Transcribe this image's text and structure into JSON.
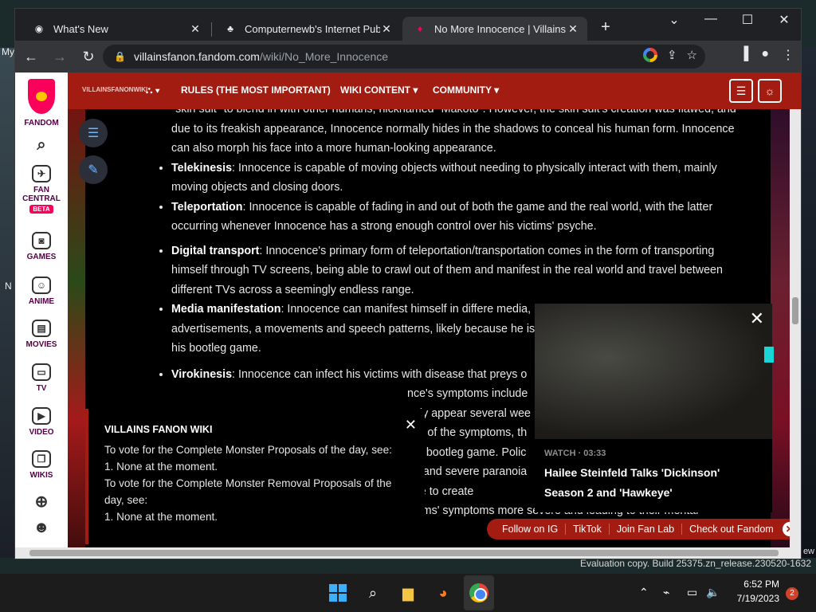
{
  "browser": {
    "tabs": [
      {
        "title": "What's New",
        "icon": "chrome-icon"
      },
      {
        "title": "Computernewb's Internet Pub H",
        "icon": "pub-icon"
      },
      {
        "title": "No More Innocence | Villains Far",
        "icon": "fandom-icon"
      }
    ],
    "url_domain": "villainsfanon.fandom.com",
    "url_path": "/wiki/No_More_Innocence"
  },
  "desktop": {
    "label_my": "My",
    "label_n": "N",
    "label_ew": "ew",
    "watermark": "Evaluation copy. Build 25375.zn_release.230520-1632"
  },
  "rail": {
    "brand": "FANDOM",
    "items": [
      {
        "label": "FAN CENTRAL",
        "badge": "BETA"
      },
      {
        "label": "GAMES"
      },
      {
        "label": "ANIME"
      },
      {
        "label": "MOVIES"
      },
      {
        "label": "TV"
      },
      {
        "label": "VIDEO"
      },
      {
        "label": "WIKIS"
      }
    ]
  },
  "wiki_nav": {
    "logo_text": "VILLAINSFANONWIKI",
    "items": [
      "RULES (THE MOST IMPORTANT)",
      "WIKI CONTENT",
      "COMMUNITY"
    ]
  },
  "article": {
    "intro": "\"skin suit\" to blend in with other humans, nicknamed \"Makoto\". However, the skin suit's creation was flawed, and due to its freakish appearance, Innocence normally hides in the shadows to conceal his human form. Innocence can also morph his face into a more human-looking appearance.",
    "telekinesis_term": "Telekinesis",
    "telekinesis_text": ": Innocence is capable of moving objects without needing to physically interact with them, mainly moving objects and closing doors.",
    "teleportation_term": "Teleportation",
    "teleportation_text": ": Innocence is capable of fading in and out of both the game and the real world, with the latter occurring whenever Innocence has a strong enough control over his victims' psyche.",
    "digital_term": "Digital transport",
    "digital_text": ": Innocence's primary form of teleportation/transportation comes in the form of transporting himself through TV screens, being able to crawl out of them and manifest in the real world and travel between different TVs across a seemingly endless range.",
    "media_term": "Media manifestation",
    "media_text": ": Innocence can manifest himself in differe media, namely newspapers, phone calls and TV advertisements, a movements and speech patterns, likely because he isn't as powe to how he is normally within his bootleg game.",
    "virokinesis_term": "Virokinesis",
    "virokinesis_text": ": Innocence can infect his victims with disease that preys o",
    "fragments": [
      "nce's symptoms include",
      "only appear several wee",
      "sity of the symptoms, th",
      "the bootleg game. Polic",
      "ep and severe paranoia"
    ],
    "bottom_line1": "Disease augmentation: As well as being able to create",
    "bottom_line2": "enhance their effectiveness, making his victims' symptoms more severe and leading to their mental"
  },
  "notice": {
    "title": "VILLAINS FANON WIKI",
    "line1": "To vote for the Complete Monster Proposals of the day, see:",
    "line2": "1. None at the moment.",
    "line3": "To vote for the Complete Monster Removal Proposals of the day, see:",
    "line4": "1. None at the moment."
  },
  "video": {
    "meta": "WATCH · 03:33",
    "title": "Hailee Steinfeld Talks 'Dickinson' Season 2 and 'Hawkeye'"
  },
  "social": {
    "items": [
      "Follow on IG",
      "TikTok",
      "Join Fan Lab",
      "Check out Fandom"
    ]
  },
  "taskbar": {
    "time": "6:52 PM",
    "date": "7/19/2023",
    "notifications": "2"
  },
  "colors": {
    "wiki_red": "#a31c12",
    "fandom_pink": "#fa005a"
  }
}
